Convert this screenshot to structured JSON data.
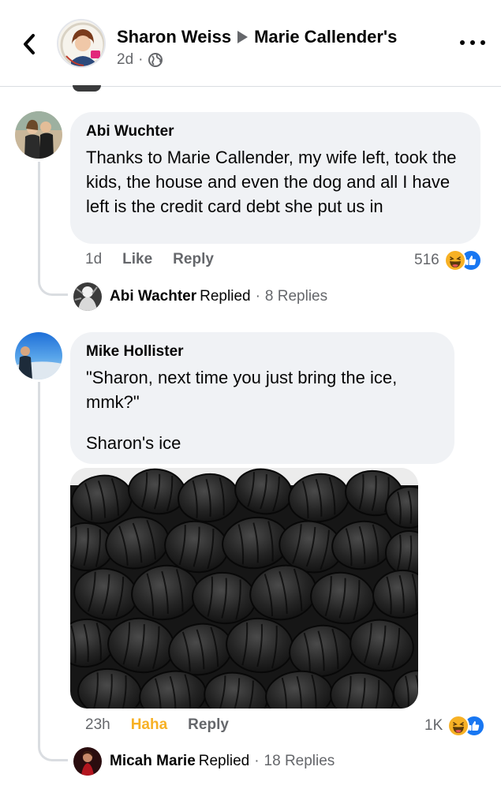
{
  "header": {
    "author": "Sharon Weiss",
    "page": "Marie Callender's",
    "time": "2d"
  },
  "comments": [
    {
      "author": "Abi Wuchter",
      "text": "Thanks to Marie Callender, my wife left, took the kids, the house and even the dog and all I have left is the credit card debt she put us in",
      "time": "1d",
      "like_label": "Like",
      "reply_label": "Reply",
      "reaction_count": "516",
      "reactions": [
        "haha-icon",
        "like-icon"
      ],
      "replies": {
        "name": "Abi Wachter",
        "replied_label": "Replied",
        "count_label": "8 Replies"
      }
    },
    {
      "author": "Mike Hollister",
      "text_line1": "\"Sharon, next time you just bring the ice, mmk?\"",
      "text_line2": "Sharon's ice",
      "time": "23h",
      "reaction_label": "Haha",
      "reply_label": "Reply",
      "reaction_count": "1K",
      "reactions": [
        "haha-icon",
        "like-icon"
      ],
      "attachment": "charcoal-briquettes-photo",
      "replies": {
        "name": "Micah Marie",
        "replied_label": "Replied",
        "count_label": "18 Replies"
      }
    }
  ],
  "colors": {
    "bubble": "#f0f2f5",
    "secondary_text": "#65676b",
    "haha": "#f7b125",
    "like_blue": "#1877f2",
    "divider": "#dadde1"
  }
}
